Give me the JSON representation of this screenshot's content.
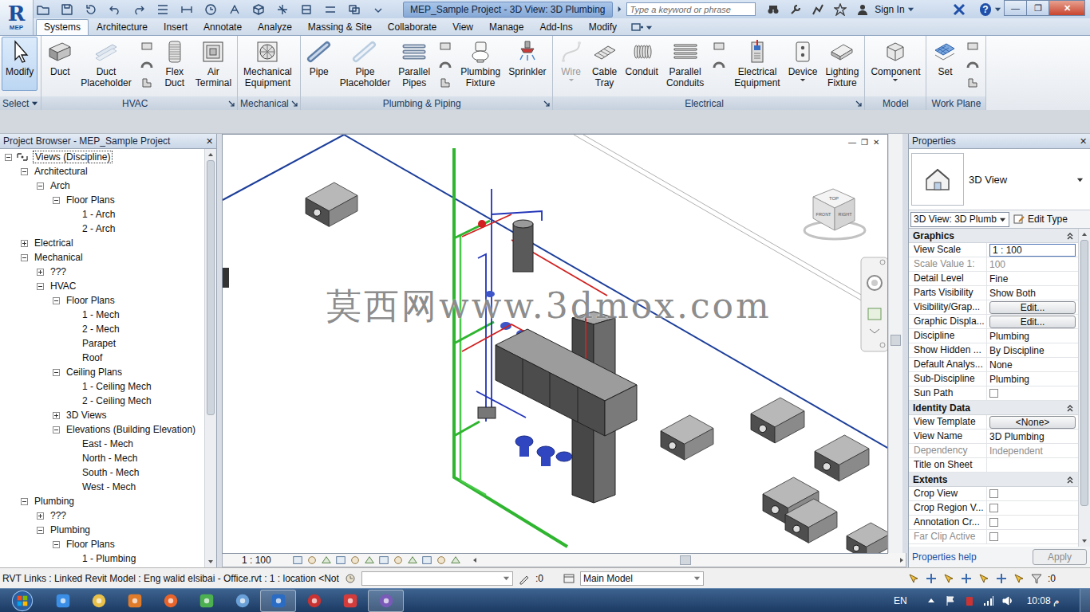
{
  "window": {
    "title": "MEP_Sample Project - 3D View: 3D Plumbing",
    "logo": "R",
    "product": "MEP",
    "controls": [
      "—",
      "❐",
      "✕"
    ]
  },
  "search": {
    "placeholder": "Type a keyword or phrase"
  },
  "account": {
    "label": "Sign In",
    "help": "?"
  },
  "ribbon_tabs": [
    {
      "label": "Systems",
      "selected": true
    },
    {
      "label": "Architecture",
      "selected": false
    },
    {
      "label": "Insert",
      "selected": false
    },
    {
      "label": "Annotate",
      "selected": false
    },
    {
      "label": "Analyze",
      "selected": false
    },
    {
      "label": "Massing & Site",
      "selected": false
    },
    {
      "label": "Collaborate",
      "selected": false
    },
    {
      "label": "View",
      "selected": false
    },
    {
      "label": "Manage",
      "selected": false
    },
    {
      "label": "Add-Ins",
      "selected": false
    },
    {
      "label": "Modify",
      "selected": false
    }
  ],
  "ribbon_panels": [
    {
      "title": "Select",
      "dropdown": true,
      "launcher": false,
      "tools": [
        {
          "kind": "large",
          "label": "Modify",
          "selected": true,
          "disabled": false,
          "dropdown": false
        }
      ]
    },
    {
      "title": "HVAC",
      "dropdown": false,
      "launcher": true,
      "tools": [
        {
          "kind": "large",
          "label": "Duct",
          "selected": false,
          "disabled": false,
          "dropdown": false
        },
        {
          "kind": "large",
          "label": "Duct Placeholder",
          "selected": false,
          "disabled": false,
          "dropdown": false
        },
        {
          "kind": "stack",
          "icons": 3
        },
        {
          "kind": "large",
          "label": "Flex Duct",
          "selected": false,
          "disabled": false,
          "dropdown": false
        },
        {
          "kind": "large",
          "label": "Air Terminal",
          "selected": false,
          "disabled": false,
          "dropdown": false
        }
      ]
    },
    {
      "title": "Mechanical",
      "dropdown": false,
      "launcher": true,
      "tools": [
        {
          "kind": "large",
          "label": "Mechanical Equipment",
          "selected": false,
          "disabled": false,
          "dropdown": false
        }
      ]
    },
    {
      "title": "Plumbing & Piping",
      "dropdown": false,
      "launcher": true,
      "tools": [
        {
          "kind": "large",
          "label": "Pipe",
          "selected": false,
          "disabled": false,
          "dropdown": false
        },
        {
          "kind": "large",
          "label": "Pipe Placeholder",
          "selected": false,
          "disabled": false,
          "dropdown": false
        },
        {
          "kind": "large",
          "label": "Parallel Pipes",
          "selected": false,
          "disabled": false,
          "dropdown": false
        },
        {
          "kind": "stack",
          "icons": 3
        },
        {
          "kind": "large",
          "label": "Plumbing Fixture",
          "selected": false,
          "disabled": false,
          "dropdown": false
        },
        {
          "kind": "large",
          "label": "Sprinkler",
          "selected": false,
          "disabled": false,
          "dropdown": false
        }
      ]
    },
    {
      "title": "Electrical",
      "dropdown": false,
      "launcher": true,
      "tools": [
        {
          "kind": "large",
          "label": "Wire",
          "selected": false,
          "disabled": true,
          "dropdown": true
        },
        {
          "kind": "large",
          "label": "Cable Tray",
          "selected": false,
          "disabled": false,
          "dropdown": false
        },
        {
          "kind": "large",
          "label": "Conduit",
          "selected": false,
          "disabled": false,
          "dropdown": false
        },
        {
          "kind": "large",
          "label": "Parallel Conduits",
          "selected": false,
          "disabled": false,
          "dropdown": false
        },
        {
          "kind": "stack",
          "icons": 2
        },
        {
          "kind": "large",
          "label": "Electrical Equipment",
          "selected": false,
          "disabled": false,
          "dropdown": false
        },
        {
          "kind": "large",
          "label": "Device",
          "selected": false,
          "disabled": false,
          "dropdown": true
        },
        {
          "kind": "large",
          "label": "Lighting Fixture",
          "selected": false,
          "disabled": false,
          "dropdown": false
        }
      ]
    },
    {
      "title": "Model",
      "dropdown": false,
      "launcher": false,
      "tools": [
        {
          "kind": "large",
          "label": "Component",
          "selected": false,
          "disabled": false,
          "dropdown": true
        }
      ]
    },
    {
      "title": "Work Plane",
      "dropdown": false,
      "launcher": false,
      "tools": [
        {
          "kind": "large",
          "label": "Set",
          "selected": false,
          "disabled": false,
          "dropdown": false
        },
        {
          "kind": "stack",
          "icons": 3
        }
      ]
    }
  ],
  "project_browser": {
    "title": "Project Browser - MEP_Sample Project",
    "close": "✕",
    "items": [
      {
        "label": "Views (Discipline)",
        "level": 0,
        "kind": "root",
        "expanded": true,
        "selected": true
      },
      {
        "label": "Architectural",
        "level": 1,
        "kind": "group",
        "expanded": true,
        "selected": false
      },
      {
        "label": "Arch",
        "level": 2,
        "kind": "group",
        "expanded": true,
        "selected": false
      },
      {
        "label": "Floor Plans",
        "level": 3,
        "kind": "group",
        "expanded": true,
        "selected": false
      },
      {
        "label": "1 - Arch",
        "level": 4,
        "kind": "view",
        "expanded": false,
        "selected": false
      },
      {
        "label": "2 - Arch",
        "level": 4,
        "kind": "view",
        "expanded": false,
        "selected": false
      },
      {
        "label": "Electrical",
        "level": 1,
        "kind": "group",
        "expanded": false,
        "selected": false
      },
      {
        "label": "Mechanical",
        "level": 1,
        "kind": "group",
        "expanded": true,
        "selected": false
      },
      {
        "label": "???",
        "level": 2,
        "kind": "group",
        "expanded": false,
        "selected": false
      },
      {
        "label": "HVAC",
        "level": 2,
        "kind": "group",
        "expanded": true,
        "selected": false
      },
      {
        "label": "Floor Plans",
        "level": 3,
        "kind": "group",
        "expanded": true,
        "selected": false
      },
      {
        "label": "1 - Mech",
        "level": 4,
        "kind": "view",
        "expanded": false,
        "selected": false
      },
      {
        "label": "2 - Mech",
        "level": 4,
        "kind": "view",
        "expanded": false,
        "selected": false
      },
      {
        "label": "Parapet",
        "level": 4,
        "kind": "view",
        "expanded": false,
        "selected": false
      },
      {
        "label": "Roof",
        "level": 4,
        "kind": "view",
        "expanded": false,
        "selected": false
      },
      {
        "label": "Ceiling Plans",
        "level": 3,
        "kind": "group",
        "expanded": true,
        "selected": false
      },
      {
        "label": "1 - Ceiling Mech",
        "level": 4,
        "kind": "view",
        "expanded": false,
        "selected": false
      },
      {
        "label": "2 - Ceiling Mech",
        "level": 4,
        "kind": "view",
        "expanded": false,
        "selected": false
      },
      {
        "label": "3D Views",
        "level": 3,
        "kind": "group",
        "expanded": false,
        "selected": false
      },
      {
        "label": "Elevations (Building Elevation)",
        "level": 3,
        "kind": "group",
        "expanded": true,
        "selected": false
      },
      {
        "label": "East - Mech",
        "level": 4,
        "kind": "view",
        "expanded": false,
        "selected": false
      },
      {
        "label": "North - Mech",
        "level": 4,
        "kind": "view",
        "expanded": false,
        "selected": false
      },
      {
        "label": "South - Mech",
        "level": 4,
        "kind": "view",
        "expanded": false,
        "selected": false
      },
      {
        "label": "West - Mech",
        "level": 4,
        "kind": "view",
        "expanded": false,
        "selected": false
      },
      {
        "label": "Plumbing",
        "level": 1,
        "kind": "group",
        "expanded": true,
        "selected": false
      },
      {
        "label": "???",
        "level": 2,
        "kind": "group",
        "expanded": false,
        "selected": false
      },
      {
        "label": "Plumbing",
        "level": 2,
        "kind": "group",
        "expanded": true,
        "selected": false
      },
      {
        "label": "Floor Plans",
        "level": 3,
        "kind": "group",
        "expanded": true,
        "selected": false
      },
      {
        "label": "1 - Plumbing",
        "level": 4,
        "kind": "view",
        "expanded": false,
        "selected": false
      }
    ]
  },
  "view": {
    "watermark": "莫西网www.3dmox.com",
    "scale": "1 : 100",
    "viewcube": {
      "top": "TOP",
      "front": "FRONT",
      "right": "RIGHT"
    },
    "controls": [
      "—",
      "❐",
      "✕"
    ]
  },
  "properties": {
    "title": "Properties",
    "close": "✕",
    "type_name": "3D View",
    "instance": "3D View: 3D Plumb",
    "edit_type": "Edit Type",
    "rows": [
      {
        "kind": "section",
        "label": "Graphics",
        "expanded": true
      },
      {
        "kind": "input",
        "label": "View Scale",
        "value": "1 : 100",
        "disabled": false
      },
      {
        "kind": "text",
        "label": "Scale Value 1:",
        "value": "100",
        "disabled": true
      },
      {
        "kind": "text",
        "label": "Detail Level",
        "value": "Fine",
        "disabled": false
      },
      {
        "kind": "text",
        "label": "Parts Visibility",
        "value": "Show Both",
        "disabled": false
      },
      {
        "kind": "button",
        "label": "Visibility/Grap...",
        "value": "Edit...",
        "disabled": false
      },
      {
        "kind": "button",
        "label": "Graphic Displa...",
        "value": "Edit...",
        "disabled": false
      },
      {
        "kind": "text",
        "label": "Discipline",
        "value": "Plumbing",
        "disabled": false
      },
      {
        "kind": "text",
        "label": "Show Hidden ...",
        "value": "By Discipline",
        "disabled": false
      },
      {
        "kind": "text",
        "label": "Default Analys...",
        "value": "None",
        "disabled": false
      },
      {
        "kind": "text",
        "label": "Sub-Discipline",
        "value": "Plumbing",
        "disabled": false
      },
      {
        "kind": "checkbox",
        "label": "Sun Path",
        "checked": false,
        "disabled": false
      },
      {
        "kind": "section",
        "label": "Identity Data",
        "expanded": true
      },
      {
        "kind": "button",
        "label": "View Template",
        "value": "<None>",
        "disabled": false
      },
      {
        "kind": "text",
        "label": "View Name",
        "value": "3D Plumbing",
        "disabled": false
      },
      {
        "kind": "text",
        "label": "Dependency",
        "value": "Independent",
        "disabled": true
      },
      {
        "kind": "text",
        "label": "Title on Sheet",
        "value": "",
        "disabled": false
      },
      {
        "kind": "section",
        "label": "Extents",
        "expanded": true
      },
      {
        "kind": "checkbox",
        "label": "Crop View",
        "checked": false,
        "disabled": false
      },
      {
        "kind": "checkbox",
        "label": "Crop Region V...",
        "checked": false,
        "disabled": false
      },
      {
        "kind": "checkbox",
        "label": "Annotation Cr...",
        "checked": false,
        "disabled": false
      },
      {
        "kind": "checkbox",
        "label": "Far Clip Active",
        "checked": false,
        "disabled": true
      }
    ],
    "help": "Properties help",
    "apply": {
      "label": "Apply",
      "disabled": true
    }
  },
  "status_bar": {
    "text": "RVT Links : Linked Revit Model : Eng walid elsibai - Office.rvt : 1 : location <Not",
    "editing_count": ":0",
    "model": "Main Model",
    "filter_count": ":0"
  },
  "taskbar": {
    "language": "EN",
    "time": "10:08 م",
    "apps": [
      {
        "active": false
      },
      {
        "active": false
      },
      {
        "active": false
      },
      {
        "active": false
      },
      {
        "active": false
      },
      {
        "active": false
      },
      {
        "active": true
      },
      {
        "active": false
      },
      {
        "active": false
      },
      {
        "active": true
      }
    ]
  }
}
